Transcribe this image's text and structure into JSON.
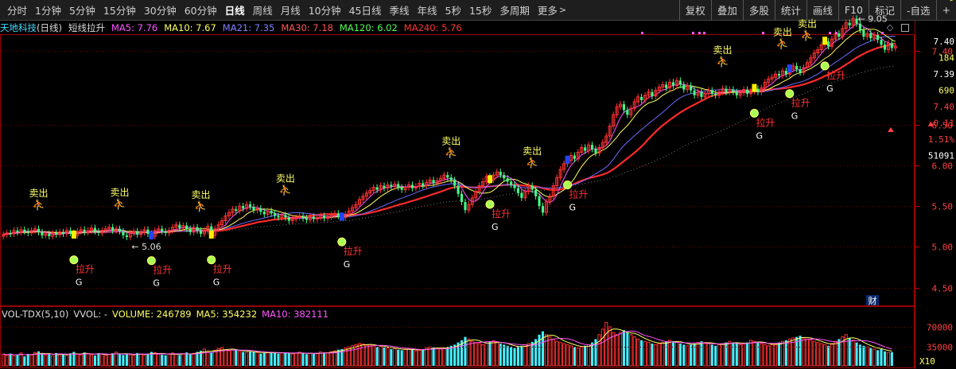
{
  "toolbar": {
    "periods": [
      "分时",
      "1分钟",
      "5分钟",
      "15分钟",
      "30分钟",
      "60分钟",
      "日线",
      "周线",
      "月线",
      "10分钟",
      "45日线",
      "季线",
      "年线",
      "5秒",
      "15秒",
      "多周期",
      "更多"
    ],
    "active_period": "日线",
    "more_chevron": ">",
    "right_buttons": [
      "复权",
      "叠加",
      "多股",
      "统计",
      "画线",
      "F10",
      "标记",
      "-自选",
      "+"
    ]
  },
  "main_legend": {
    "stock_name": "天地科技",
    "period_tag": "(日线)",
    "indicator_name": "短线拉升",
    "ma": [
      {
        "label": "MA5: 7.76",
        "color": "#ff55ff"
      },
      {
        "label": "MA10: 7.67",
        "color": "#ffff66"
      },
      {
        "label": "MA21: 7.35",
        "color": "#8080ff"
      },
      {
        "label": "MA30: 7.18",
        "color": "#ff5555"
      },
      {
        "label": "MA120: 6.02",
        "color": "#55ff55"
      },
      {
        "label": "MA240: 5.76",
        "color": "#ff3333"
      }
    ]
  },
  "price_axis": {
    "ticks": [
      "7.40",
      "7.40",
      "6.50",
      "6.00",
      "5.50",
      "5.00",
      "4.50"
    ],
    "tick_values": [
      7.4,
      6.5,
      6.0,
      5.5,
      5.0,
      4.5
    ],
    "top_labels": [
      "7.40",
      "184",
      "7.39",
      "690",
      "7.40",
      "▲0.11",
      "1.51%",
      "51091"
    ]
  },
  "chart_data": {
    "type": "candlestick",
    "ylim": [
      4.3,
      7.6
    ],
    "annotations": {
      "high_label": "9.05",
      "low_label": "5.06",
      "sell_text": "卖出",
      "buy_text": "拉升",
      "g_text": "G",
      "fin_marker": "财"
    },
    "sell_signals": [
      10,
      33,
      56,
      80,
      127,
      150,
      204,
      221,
      228,
      271
    ],
    "buy_signals": [
      20,
      42,
      59,
      96,
      138,
      160,
      213,
      223,
      233
    ],
    "close": [
      5.15,
      5.17,
      5.16,
      5.2,
      5.18,
      5.21,
      5.19,
      5.17,
      5.2,
      5.22,
      5.18,
      5.14,
      5.16,
      5.13,
      5.17,
      5.15,
      5.18,
      5.16,
      5.2,
      5.17,
      5.14,
      5.19,
      5.21,
      5.18,
      5.2,
      5.23,
      5.19,
      5.17,
      5.2,
      5.22,
      5.24,
      5.2,
      5.22,
      5.19,
      5.14,
      5.12,
      5.17,
      5.19,
      5.15,
      5.18,
      5.21,
      5.16,
      5.13,
      5.2,
      5.22,
      5.19,
      5.17,
      5.2,
      5.24,
      5.27,
      5.23,
      5.26,
      5.22,
      5.18,
      5.24,
      5.2,
      5.16,
      5.2,
      5.25,
      5.14,
      5.22,
      5.27,
      5.32,
      5.38,
      5.42,
      5.46,
      5.44,
      5.5,
      5.47,
      5.52,
      5.49,
      5.45,
      5.47,
      5.43,
      5.4,
      5.44,
      5.41,
      5.38,
      5.36,
      5.39,
      5.36,
      5.32,
      5.34,
      5.36,
      5.38,
      5.35,
      5.33,
      5.37,
      5.34,
      5.36,
      5.38,
      5.35,
      5.37,
      5.39,
      5.41,
      5.38,
      5.36,
      5.4,
      5.44,
      5.48,
      5.52,
      5.58,
      5.62,
      5.66,
      5.69,
      5.73,
      5.7,
      5.75,
      5.72,
      5.76,
      5.74,
      5.77,
      5.73,
      5.7,
      5.73,
      5.76,
      5.72,
      5.74,
      5.78,
      5.75,
      5.79,
      5.82,
      5.78,
      5.81,
      5.84,
      5.88,
      5.85,
      5.82,
      5.75,
      5.65,
      5.55,
      5.45,
      5.52,
      5.6,
      5.68,
      5.75,
      5.8,
      5.86,
      5.82,
      5.88,
      5.92,
      5.88,
      5.84,
      5.8,
      5.76,
      5.72,
      5.66,
      5.6,
      5.68,
      5.75,
      5.7,
      5.62,
      5.5,
      5.42,
      5.55,
      5.62,
      5.75,
      5.85,
      5.95,
      6.02,
      6.06,
      6.12,
      6.08,
      6.16,
      6.22,
      6.18,
      6.25,
      6.2,
      6.15,
      6.22,
      6.28,
      6.36,
      6.48,
      6.62,
      6.72,
      6.75,
      6.68,
      6.62,
      6.7,
      6.78,
      6.84,
      6.8,
      6.86,
      6.9,
      6.85,
      6.92,
      6.96,
      6.99,
      6.95,
      7.02,
      6.98,
      7.04,
      6.99,
      6.93,
      6.98,
      6.92,
      6.86,
      6.9,
      6.84,
      6.88,
      6.92,
      6.88,
      6.86,
      6.9,
      6.94,
      6.9,
      6.93,
      6.9,
      6.86,
      6.89,
      6.93,
      6.88,
      6.91,
      6.94,
      6.9,
      6.95,
      7.02,
      7.06,
      7.08,
      7.12,
      7.1,
      7.16,
      7.12,
      7.18,
      7.22,
      7.18,
      7.14,
      7.2,
      7.26,
      7.32,
      7.38,
      7.42,
      7.48,
      7.52,
      7.46,
      7.55,
      7.62,
      7.58,
      7.68,
      7.75,
      7.72,
      7.8,
      7.74,
      7.66,
      7.58,
      7.62,
      7.56,
      7.6,
      7.54,
      7.48,
      7.42,
      7.5,
      7.44,
      7.46
    ],
    "volume": {
      "legend": {
        "name": "VOL-TDX(5,10)",
        "vvol": "VVOL: -",
        "volume": "VOLUME: 246789",
        "ma5": "MA5: 354232",
        "ma10": "MA10: 382111"
      },
      "ticks": [
        "70000",
        "35000"
      ],
      "tick_values": [
        700000,
        350000
      ],
      "unit": "X10",
      "values": [
        210000,
        190000,
        220000,
        180000,
        200000,
        230000,
        170000,
        215000,
        195000,
        240000,
        260000,
        210000,
        190000,
        205000,
        180000,
        230000,
        215000,
        200000,
        185000,
        225000,
        250000,
        210000,
        195000,
        240000,
        220000,
        200000,
        185000,
        230000,
        215000,
        190000,
        205000,
        225000,
        245000,
        210000,
        195000,
        215000,
        200000,
        190000,
        230000,
        210000,
        195000,
        220000,
        250000,
        235000,
        210000,
        200000,
        190000,
        215000,
        230000,
        205000,
        195000,
        220000,
        240000,
        210000,
        225000,
        250000,
        270000,
        300000,
        260000,
        240000,
        280000,
        310000,
        330000,
        290000,
        270000,
        300000,
        280000,
        260000,
        250000,
        240000,
        260000,
        250000,
        240000,
        220000,
        230000,
        240000,
        250000,
        230000,
        220000,
        235000,
        240000,
        225000,
        215000,
        230000,
        245000,
        220000,
        210000,
        225000,
        215000,
        230000,
        250000,
        240000,
        235000,
        255000,
        270000,
        290000,
        300000,
        320000,
        340000,
        360000,
        380000,
        400000,
        390000,
        370000,
        380000,
        360000,
        340000,
        350000,
        330000,
        320000,
        300000,
        310000,
        290000,
        280000,
        300000,
        310000,
        290000,
        270000,
        280000,
        300000,
        320000,
        340000,
        330000,
        310000,
        300000,
        320000,
        340000,
        360000,
        380000,
        420000,
        460000,
        520000,
        480000,
        440000,
        420000,
        400000,
        380000,
        410000,
        430000,
        450000,
        420000,
        400000,
        380000,
        360000,
        340000,
        320000,
        340000,
        360000,
        380000,
        400000,
        430000,
        480000,
        560000,
        620000,
        560000,
        520000,
        480000,
        440000,
        420000,
        400000,
        380000,
        360000,
        340000,
        320000,
        340000,
        360000,
        380000,
        420000,
        480000,
        560000,
        660000,
        780000,
        700000,
        600000,
        560000,
        600000,
        640000,
        600000,
        560000,
        520000,
        480000,
        460000,
        440000,
        420000,
        400000,
        380000,
        400000,
        420000,
        440000,
        460000,
        440000,
        420000,
        400000,
        380000,
        360000,
        380000,
        400000,
        420000,
        440000,
        420000,
        400000,
        380000,
        360000,
        380000,
        400000,
        420000,
        440000,
        420000,
        400000,
        380000,
        400000,
        420000,
        460000,
        440000,
        420000,
        400000,
        380000,
        360000,
        380000,
        400000,
        420000,
        440000,
        460000,
        480000,
        500000,
        520000,
        540000,
        500000,
        480000,
        460000,
        440000,
        420000,
        400000,
        380000,
        360000,
        400000,
        440000,
        480000,
        520000,
        560000,
        500000,
        460000,
        420000,
        380000,
        360000,
        340000,
        320000,
        300000,
        280000,
        300000,
        260000,
        240000,
        246789
      ]
    }
  }
}
